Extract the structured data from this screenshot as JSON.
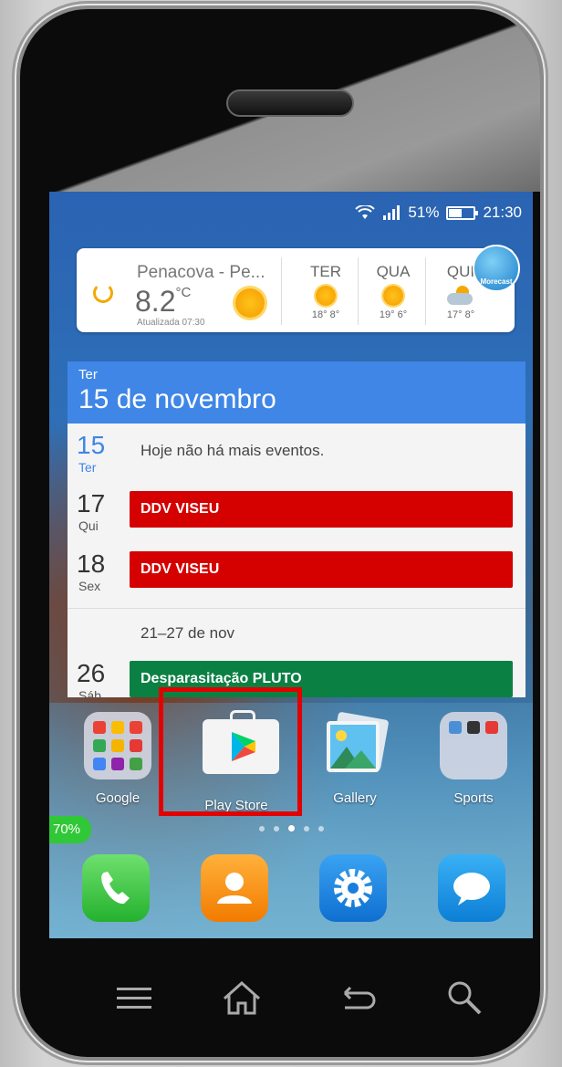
{
  "status": {
    "signal": "⋯",
    "battery_pct": "51%",
    "time": "21:30"
  },
  "weather": {
    "location": "Penacova - Pe...",
    "temp": "8.2",
    "unit": "°C",
    "updated": "Atualizada 07:30",
    "days": [
      {
        "name": "TER",
        "range": "18° 8°",
        "icon": "sun-icon"
      },
      {
        "name": "QUA",
        "range": "19° 6°",
        "icon": "sun-icon"
      },
      {
        "name": "QUI",
        "range": "17° 8°",
        "icon": "partly-cloudy-icon"
      }
    ],
    "brand": "Morecast"
  },
  "calendar": {
    "header_dow": "Ter",
    "header_date": "15 de novembro",
    "rows": [
      {
        "day": "15",
        "dow": "Ter",
        "text": "Hoje não há mais eventos."
      },
      {
        "day": "17",
        "dow": "Qui",
        "text": "DDV VISEU",
        "color": "#d50000"
      },
      {
        "day": "18",
        "dow": "Sex",
        "text": "DDV VISEU",
        "color": "#d50000"
      },
      {
        "week": "21–27 de nov"
      },
      {
        "day": "26",
        "dow": "Sáb",
        "text": "Desparasitação PLUTO",
        "color": "#0b8043"
      }
    ]
  },
  "apps": [
    {
      "label": "Google"
    },
    {
      "label": "Play Store"
    },
    {
      "label": "Gallery"
    },
    {
      "label": "Sports"
    }
  ],
  "page_indicator": {
    "count": 5,
    "active": 2
  },
  "battery_badge": "70%",
  "dock": [
    "phone",
    "contacts",
    "settings",
    "messages"
  ],
  "colors": {
    "highlight": "#e20000",
    "calendar_blue": "#3f86e6"
  }
}
